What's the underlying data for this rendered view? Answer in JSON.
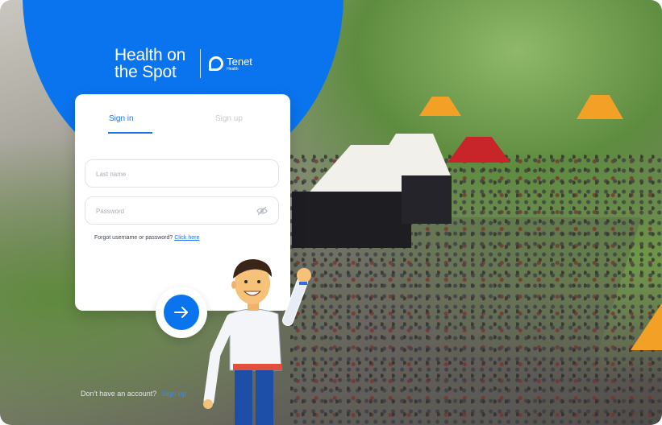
{
  "brand": {
    "product_line1": "Health on",
    "product_line2": "the Spot",
    "partner_name": "Tenet",
    "partner_sub": "Health"
  },
  "tabs": [
    {
      "label": "Sign in",
      "active": true
    },
    {
      "label": "Sign up",
      "active": false
    }
  ],
  "form": {
    "last_name_placeholder": "Last name",
    "password_placeholder": "Password",
    "forgot_text": "Forgot username or password?",
    "forgot_link": "Click here"
  },
  "footer": {
    "prompt": "Don't have an account?",
    "signup_link": "Sign up"
  },
  "icons": {
    "submit": "arrow-right-icon",
    "password_toggle": "eye-off-icon"
  },
  "colors": {
    "accent": "#0a74ef",
    "link": "#1a73e8",
    "card": "#ffffff"
  }
}
